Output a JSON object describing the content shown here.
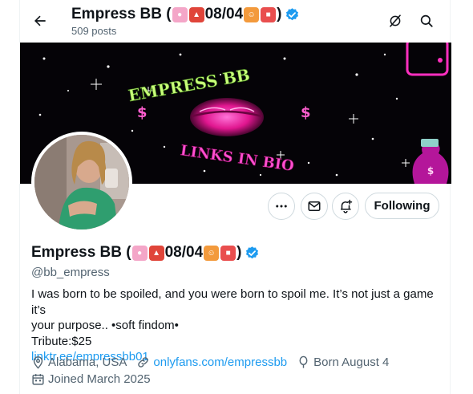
{
  "header": {
    "title_prefix": "Empress BB (",
    "title_date": "08/04",
    "title_suffix": ")",
    "posts": "509 posts",
    "icons": [
      "back-arrow-icon",
      "grok-icon",
      "search-icon"
    ]
  },
  "banner": {
    "text_top": "EMPRESS BB",
    "text_bottom": "LINKS IN BIO",
    "dollar": "$"
  },
  "actions": {
    "follow_label": "Following",
    "icons": [
      "more-icon",
      "message-icon",
      "notify-icon"
    ]
  },
  "profile": {
    "name_prefix": "Empress BB (",
    "name_date": "08/04",
    "name_suffix": ")",
    "handle": "@bb_empress",
    "bio_line1": "I was born to be spoiled, and you were born to spoil me. It’s not just a game it’s",
    "bio_line2": "your purpose.. •soft findom•",
    "bio_line3": "Tribute:$25",
    "bio_link": "linktr.ee/empressbb01",
    "location": "Alabama, USA",
    "website": "onlyfans.com/empressbb",
    "birthday": "Born August 4",
    "joined": "Joined March 2025"
  },
  "colors": {
    "accent": "#1d9bf0",
    "secondary_text": "#536471",
    "banner_pink": "#ff2fbf",
    "banner_green": "#b8ff6a"
  }
}
